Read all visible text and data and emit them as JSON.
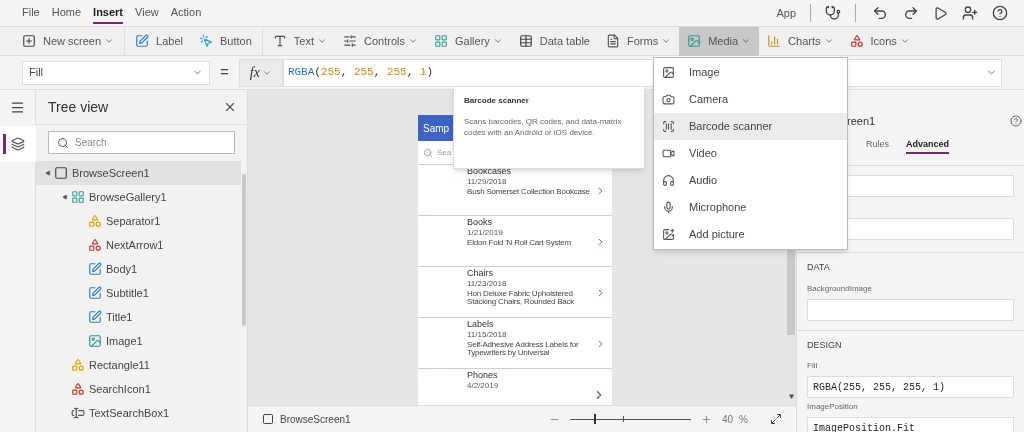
{
  "menu_bar": {
    "tabs": [
      {
        "label": "File",
        "selected": false
      },
      {
        "label": "Home",
        "selected": false
      },
      {
        "label": "Insert",
        "selected": true
      },
      {
        "label": "View",
        "selected": false
      },
      {
        "label": "Action",
        "selected": false
      }
    ],
    "app_label": "App"
  },
  "toolbar": [
    {
      "items": [
        {
          "label": "New screen",
          "kind": "screen",
          "has_menu": true,
          "selected": false
        }
      ]
    },
    {
      "items": [
        {
          "label": "Label",
          "kind": "label",
          "has_menu": false,
          "selected": false
        },
        {
          "label": "Button",
          "kind": "button",
          "has_menu": false,
          "selected": false
        }
      ]
    },
    {
      "items": [
        {
          "label": "Text",
          "kind": "text",
          "has_menu": true,
          "selected": false
        },
        {
          "label": "Controls",
          "kind": "controls",
          "has_menu": true,
          "selected": false
        },
        {
          "label": "Gallery",
          "kind": "gallery",
          "has_menu": true,
          "selected": false
        },
        {
          "label": "Data table",
          "kind": "table",
          "has_menu": false,
          "selected": false
        },
        {
          "label": "Forms",
          "kind": "forms",
          "has_menu": true,
          "selected": false
        },
        {
          "label": "Media",
          "kind": "media",
          "has_menu": true,
          "selected": true
        },
        {
          "label": "Charts",
          "kind": "charts",
          "has_menu": true,
          "selected": false
        },
        {
          "label": "Icons",
          "kind": "icons",
          "has_menu": true,
          "selected": false
        }
      ]
    }
  ],
  "formula_bar": {
    "property": "Fill",
    "equals": "=",
    "fx_label": "fx",
    "formula": [
      {
        "text": "RGBA",
        "kind": "function"
      },
      {
        "text": "(",
        "kind": "punct"
      },
      {
        "text": "255",
        "kind": "number"
      },
      {
        "text": ", ",
        "kind": "punct"
      },
      {
        "text": "255",
        "kind": "number"
      },
      {
        "text": ", ",
        "kind": "punct"
      },
      {
        "text": "255",
        "kind": "number"
      },
      {
        "text": ", ",
        "kind": "punct"
      },
      {
        "text": "1",
        "kind": "number"
      },
      {
        "text": ")",
        "kind": "punct"
      }
    ]
  },
  "tree_view": {
    "title": "Tree view",
    "search_placeholder": "Search",
    "items": [
      {
        "label": "BrowseScreen1",
        "kind": "screen",
        "selected": true,
        "expanded": true,
        "children": [
          {
            "label": "BrowseGallery1",
            "kind": "gallery",
            "selected": false,
            "expanded": true,
            "children": [
              {
                "label": "Separator1",
                "kind": "shape",
                "selected": false
              },
              {
                "label": "NextArrow1",
                "kind": "icons",
                "selected": false
              },
              {
                "label": "Body1",
                "kind": "label",
                "selected": false
              },
              {
                "label": "Subtitle1",
                "kind": "label",
                "selected": false
              },
              {
                "label": "Title1",
                "kind": "label",
                "selected": false
              },
              {
                "label": "Image1",
                "kind": "image",
                "selected": false
              }
            ]
          },
          {
            "label": "Rectangle11",
            "kind": "shape",
            "selected": false
          },
          {
            "label": "SearchIcon1",
            "kind": "icons",
            "selected": false
          },
          {
            "label": "TextSearchBox1",
            "kind": "textinput",
            "selected": false
          }
        ]
      }
    ]
  },
  "canvas": {
    "app_header": "Samp",
    "search_placeholder": "Sea",
    "items": [
      {
        "title": "Bookcases",
        "date": "11/29/2018",
        "description": "Bush Somerset Collection Bookcase"
      },
      {
        "title": "Books",
        "date": "1/21/2019",
        "description": "Eldon Fold 'N Roll Cart System"
      },
      {
        "title": "Chairs",
        "date": "11/23/2018",
        "description": "Hon Deluxe Fabric Upholstered Stacking Chairs, Rounded Back"
      },
      {
        "title": "Labels",
        "date": "11/15/2018",
        "description": "Self-Adhesive Address Labels for Typewriters by Universal"
      },
      {
        "title": "Phones",
        "date": "4/2/2019"
      }
    ]
  },
  "status_bar": {
    "screen": "BrowseScreen1",
    "level": 0.2,
    "zoom": "40",
    "percent": "%"
  },
  "properties": {
    "title": "reen1",
    "tabs": [
      {
        "label": "Rules",
        "selected": false
      },
      {
        "label": "Advanced",
        "selected": true
      }
    ],
    "sections": [
      {
        "heading": "DATA",
        "fields": [
          {
            "label": "BackgroundImage"
          }
        ]
      },
      {
        "heading": "DESIGN",
        "fields": [
          {
            "label": "Fill",
            "value": "RGBA(255, 255, 255, 1)"
          },
          {
            "label": "ImagePosition",
            "value": "ImagePosition.Fit"
          }
        ]
      }
    ]
  },
  "media_menu": {
    "items": [
      {
        "label": "Image",
        "kind": "image",
        "selected": false
      },
      {
        "label": "Camera",
        "kind": "camera",
        "selected": false
      },
      {
        "label": "Barcode scanner",
        "kind": "barcode",
        "selected": true
      },
      {
        "label": "Video",
        "kind": "video",
        "selected": false
      },
      {
        "label": "Audio",
        "kind": "audio",
        "selected": false
      },
      {
        "label": "Microphone",
        "kind": "microphone",
        "selected": false
      },
      {
        "label": "Add picture",
        "kind": "addpicture",
        "selected": false
      }
    ]
  },
  "tooltip": {
    "title": "Barcode scanner",
    "text": "Scans barcodes, QR codes, and data-matrix codes with an Android or iOS device."
  }
}
